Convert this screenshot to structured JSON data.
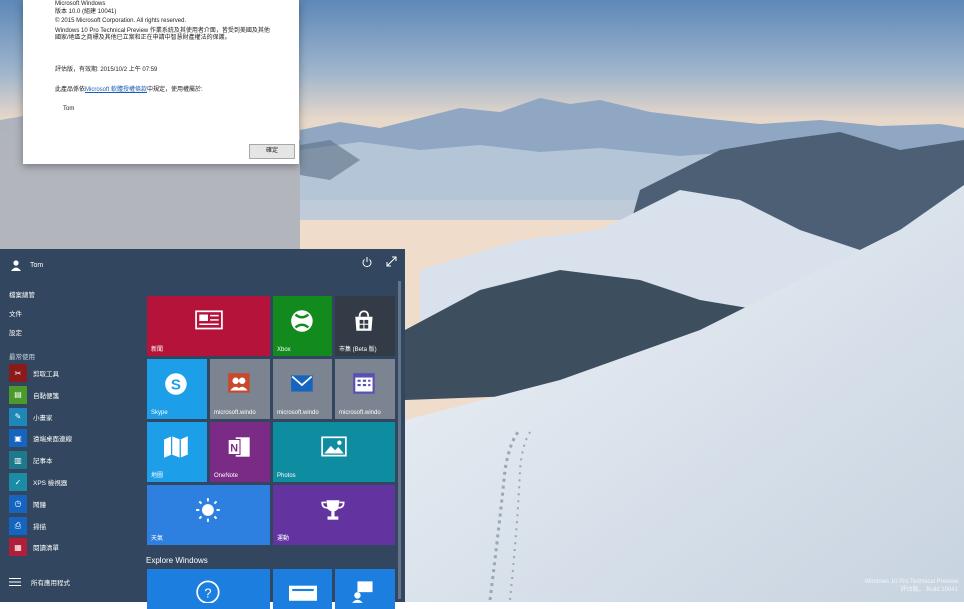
{
  "about_dialog": {
    "product": "Microsoft Windows",
    "version": "版本 10.0 (組建 10041)",
    "copyright": "© 2015 Microsoft Corporation. All rights reserved.",
    "license_notice": "Windows 10 Pro Technical Preview 作業系統及其使用者介面，皆受到美國及其他國家/地區之商標及其他已立案和正在申請中智慧財產權法的保護。",
    "eval_expires": "評估版，有效期: 2015/10/2 上午 07:59",
    "terms_prefix": "此產品係依",
    "terms_link": "Microsoft 軟體授權條款",
    "terms_suffix": "中規定，使用權屬於:",
    "licensed_user": "Tom",
    "ok_button": "確定"
  },
  "start_menu": {
    "user_name": "Tom",
    "places": [
      "檔案總管",
      "文件",
      "設定"
    ],
    "most_used_header": "最常使用",
    "apps": [
      {
        "label": "剪取工具",
        "color": "#8b1a1a",
        "icon": "scissors-icon"
      },
      {
        "label": "自黏便箋",
        "color": "#4b9a2b",
        "icon": "sticky-note-icon"
      },
      {
        "label": "小畫家",
        "color": "#1f86b8",
        "icon": "paint-icon"
      },
      {
        "label": "遠端桌面連線",
        "color": "#1565c0",
        "icon": "remote-desktop-icon"
      },
      {
        "label": "記事本",
        "color": "#1d7a8c",
        "icon": "notepad-icon"
      },
      {
        "label": "XPS 檢視器",
        "color": "#1b8ca6",
        "icon": "xps-viewer-icon"
      },
      {
        "label": "鬧鐘",
        "color": "#1565c0",
        "icon": "alarm-icon"
      },
      {
        "label": "掃描",
        "color": "#1565c0",
        "icon": "scan-icon"
      },
      {
        "label": "閱讀清單",
        "color": "#b01f3a",
        "icon": "reading-list-icon"
      }
    ],
    "all_apps": "所有應用程式",
    "tiles": [
      {
        "label": "新聞",
        "color": "#b5133a",
        "icon": "news-icon"
      },
      {
        "label": "Xbox",
        "color": "#138a1e",
        "icon": "xbox-icon"
      },
      {
        "label": "市集 (Beta 版)",
        "color": "#333c46",
        "icon": "store-icon"
      },
      {
        "label": "Skype",
        "color": "#1c9ee8",
        "icon": "skype-icon"
      },
      {
        "label": "microsoft.windo",
        "color": "#7b8490",
        "icon": "people-icon"
      },
      {
        "label": "microsoft.windo",
        "color": "#7b8490",
        "icon": "mail-icon"
      },
      {
        "label": "microsoft.windo",
        "color": "#7b8490",
        "icon": "calendar-icon"
      },
      {
        "label": "地圖",
        "color": "#1c9ee8",
        "icon": "maps-icon"
      },
      {
        "label": "OneNote",
        "color": "#7a2b86",
        "icon": "onenote-icon"
      },
      {
        "label": "Photos",
        "color": "#0f8da0",
        "icon": "photos-icon"
      },
      {
        "label": "天氣",
        "color": "#2d7fe0",
        "icon": "weather-icon"
      },
      {
        "label": "運動",
        "color": "#6334a0",
        "icon": "trophy-icon"
      },
      {
        "label": "",
        "color": "#1c7fe0",
        "icon": "help-icon"
      },
      {
        "label": "",
        "color": "#1c7fe0",
        "icon": "windows-feature-icon"
      },
      {
        "label": "",
        "color": "#1c7fe0",
        "icon": "feedback-icon"
      }
    ],
    "section_title": "Explore Windows"
  },
  "desktop": {
    "watermark_line1": "Windows 10 Pro Technical Preview",
    "watermark_line2": "評估版。 Build 10041"
  },
  "colors": {
    "start_bg": "#273e58",
    "accent": "#1c9ee8"
  }
}
